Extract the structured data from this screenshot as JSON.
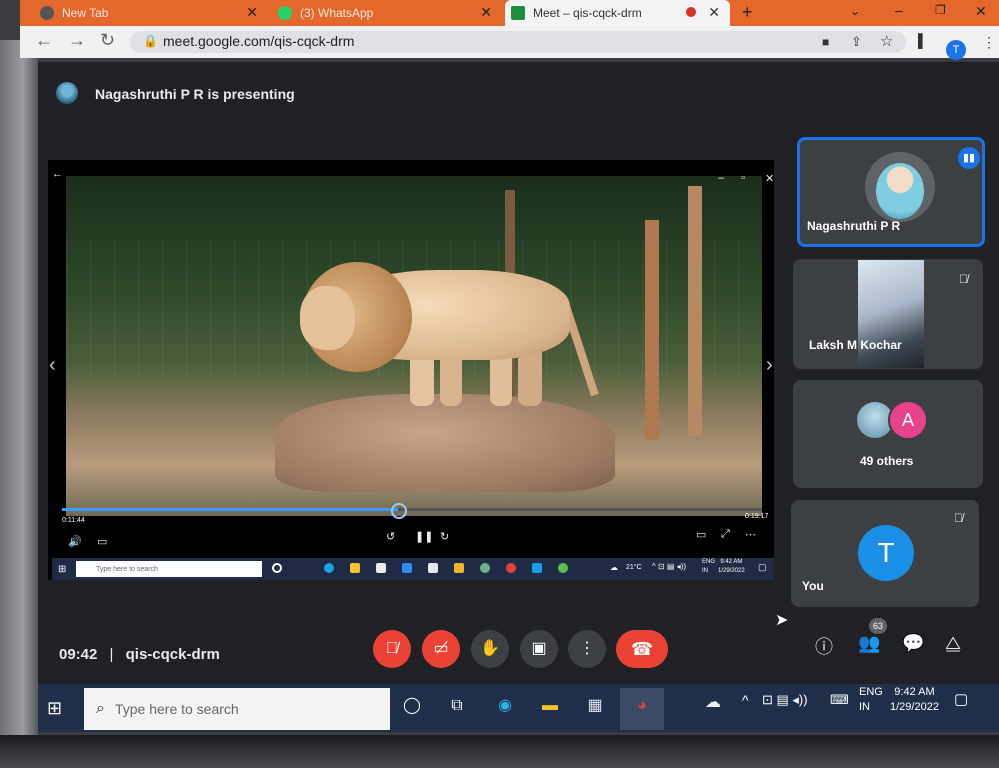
{
  "browser": {
    "tabs": [
      {
        "label": "New Tab",
        "active": false
      },
      {
        "label": "(3) WhatsApp",
        "active": false
      },
      {
        "label": "Meet – qis-cqck-drm",
        "active": true
      }
    ],
    "new_tab_label": "+",
    "url": "meet.google.com/qis-cqck-drm",
    "profile_initial": "T"
  },
  "meet": {
    "presenting_text": "Nagashruthi P R is presenting",
    "meeting_time": "09:42",
    "separator": "|",
    "meeting_code": "qis-cqck-drm",
    "participants": [
      {
        "name": "Nagashruthi P R",
        "speaking": true
      },
      {
        "name": "Laksh M Kochar",
        "muted": true
      },
      {
        "name": "49 others",
        "avatar_letter": "A"
      },
      {
        "name": "You",
        "avatar_letter": "T",
        "muted": true
      }
    ],
    "people_count": "63",
    "colors": {
      "accent": "#1a73e8",
      "danger": "#ea4335",
      "tile": "#3c4043",
      "background": "#202124"
    }
  },
  "shared_screen": {
    "video": {
      "current_time": "0:11:44",
      "total_time": "0:19:17",
      "progress": 0.48
    },
    "taskbar": {
      "search_placeholder": "Type here to search",
      "temperature": "21°C",
      "lang": "ENG",
      "region": "IN",
      "time": "9:42 AM",
      "date": "1/29/2022"
    }
  },
  "taskbar": {
    "search_placeholder": "Type here to search",
    "lang": "ENG",
    "region": "IN",
    "time": "9:42 AM",
    "date": "1/29/2022"
  }
}
